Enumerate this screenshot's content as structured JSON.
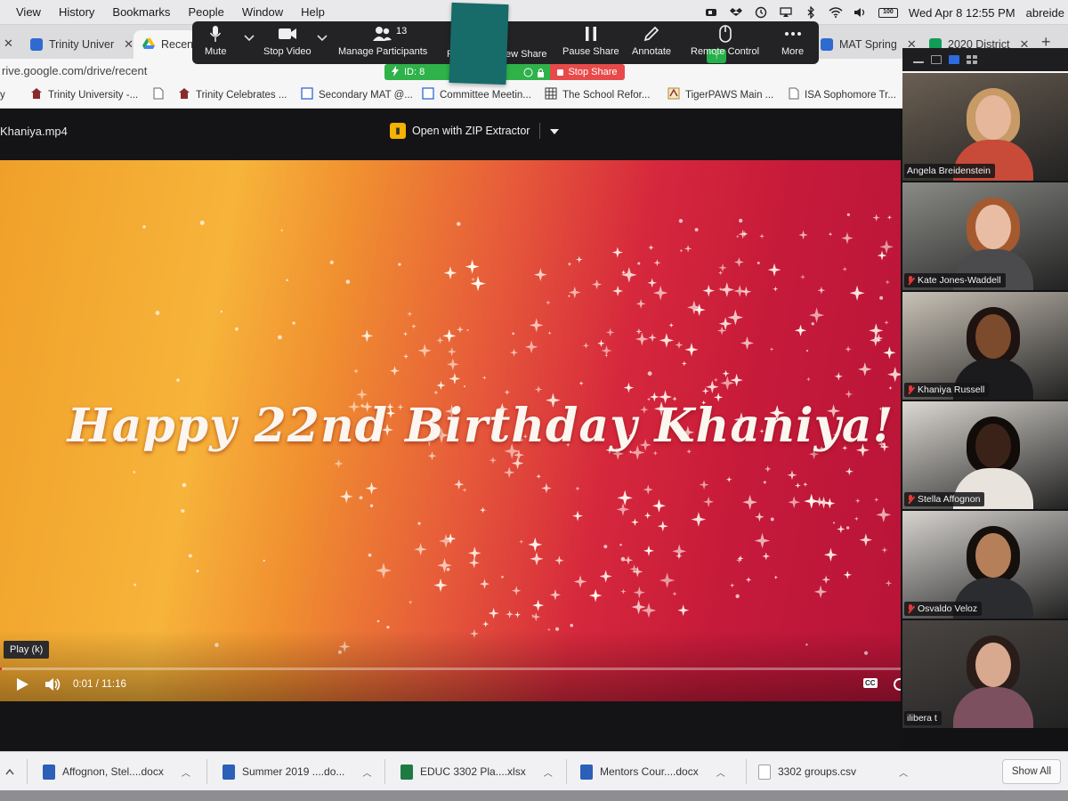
{
  "menubar": {
    "items": [
      "View",
      "History",
      "Bookmarks",
      "People",
      "Window",
      "Help"
    ],
    "clock": "Wed Apr 8  12:55 PM",
    "user": "abreide",
    "battery_label": "100"
  },
  "tabs": [
    {
      "label": "Trinity Univer",
      "favicon_color": "#2f6ad1"
    },
    {
      "label": "Recent",
      "favicon_color": "#1fa463",
      "active": true
    },
    {
      "label": "MAT Spring",
      "favicon_color": "#2f6ad1"
    },
    {
      "label": "2020 District",
      "favicon_color": "#0f9d58"
    }
  ],
  "new_tab_label": "+",
  "address": {
    "url": "rive.google.com/drive/recent"
  },
  "bookmarks": [
    {
      "label": "Trinity University -..."
    },
    {
      "label": "Trinity Celebrates ..."
    },
    {
      "label": "Secondary MAT @..."
    },
    {
      "label": "Committee Meetin..."
    },
    {
      "label": "The School Refor..."
    },
    {
      "label": "TigerPAWS Main ..."
    },
    {
      "label": "ISA Sophomore Tr..."
    }
  ],
  "zoom": {
    "mute": "Mute",
    "stop_video": "Stop Video",
    "manage_participants": "Manage Participants",
    "participant_count": "13",
    "partial_left": "R",
    "new_share": "ew Share",
    "pause_share": "Pause Share",
    "annotate": "Annotate",
    "remote_control": "Remote Control",
    "more": "More",
    "meeting_id": "ID: 8",
    "stop_share": "Stop Share",
    "share_arrow": "↑"
  },
  "player": {
    "filename": "Khaniya.mp4",
    "open_with": "Open with ZIP Extractor",
    "title_text": "Happy 22nd Birthday Khaniya!",
    "tooltip": "Play (k)",
    "time": "0:01 / 11:16",
    "progress": 0.002,
    "cc": "CC"
  },
  "participants": [
    {
      "name": "Angela Breidenstein",
      "muted": false,
      "bg": "#6b5f52",
      "skin": "#e6b79a",
      "hair": "#c79a66",
      "shirt": "#c84b3a"
    },
    {
      "name": "Kate Jones-Waddell",
      "muted": true,
      "bg": "#8a8a86",
      "skin": "#e9bda3",
      "hair": "#a5592f",
      "shirt": "#4b4b4e"
    },
    {
      "name": "Khaniya Russell",
      "muted": true,
      "bg": "#c9c2b6",
      "skin": "#7c4a2c",
      "hair": "#1e1310",
      "shirt": "#1b1b1d"
    },
    {
      "name": "Stella Affognon",
      "muted": true,
      "bg": "#dcd8d2",
      "skin": "#3b2219",
      "hair": "#110b09",
      "shirt": "#e8e3dc"
    },
    {
      "name": "Osvaldo Veloz",
      "muted": true,
      "bg": "#d6d3cf",
      "skin": "#b57f5a",
      "hair": "#16100c",
      "shirt": "#2b2c30"
    },
    {
      "name": "ilibera t",
      "muted": false,
      "bg": "#4a4542",
      "skin": "#d8a98f",
      "hair": "#2a1d19",
      "shirt": "#7d5060",
      "speaking": true
    }
  ],
  "downloads": [
    {
      "label": "Affognon, Stel....docx",
      "color": "#2b5fb8"
    },
    {
      "label": "Summer 2019 ....do...",
      "color": "#2b5fb8"
    },
    {
      "label": "EDUC 3302 Pla....xlsx",
      "color": "#1e7a43"
    },
    {
      "label": "Mentors Cour....docx",
      "color": "#2b5fb8"
    },
    {
      "label": "3302 groups.csv",
      "color": "#9aa0a6"
    }
  ],
  "show_all": "Show All"
}
